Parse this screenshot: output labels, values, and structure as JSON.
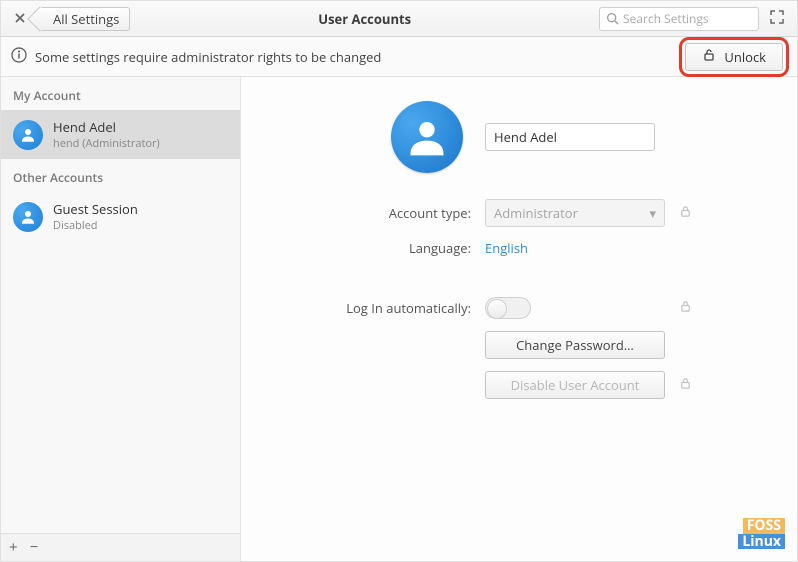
{
  "header": {
    "back_label": "All Settings",
    "title": "User Accounts",
    "search_placeholder": "Search Settings"
  },
  "infobar": {
    "message": "Some settings require administrator rights to be changed",
    "unlock_label": "Unlock"
  },
  "sidebar": {
    "section_my": "My Account",
    "section_other": "Other Accounts",
    "my_account": {
      "name": "Hend Adel",
      "sub": "hend  (Administrator)"
    },
    "other": {
      "name": "Guest Session",
      "sub": "Disabled"
    }
  },
  "detail": {
    "display_name": "Hend Adel",
    "labels": {
      "account_type": "Account type:",
      "language": "Language:",
      "auto_login": "Log In automatically:"
    },
    "account_type_value": "Administrator",
    "language_value": "English",
    "buttons": {
      "change_password": "Change Password…",
      "disable_user": "Disable User Account"
    }
  },
  "watermark": {
    "line1": "FOSS",
    "line2": "Linux"
  }
}
